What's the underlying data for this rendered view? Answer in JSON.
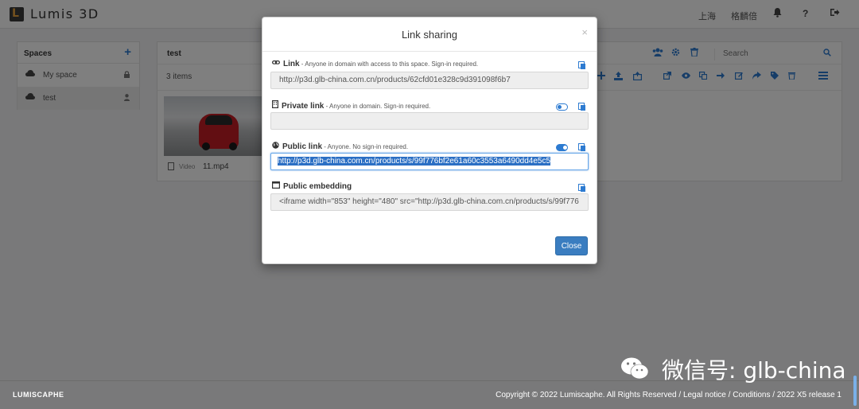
{
  "header": {
    "app_name": "Lumis 3D",
    "location": "上海",
    "user": "格麟倍",
    "bell_icon": "bell-icon",
    "help_label": "?",
    "logout_icon": "sign-out-icon"
  },
  "spaces": {
    "title": "Spaces",
    "add_label": "+",
    "items": [
      {
        "name": "My space",
        "icon": "lock-icon"
      },
      {
        "name": "test",
        "icon": "user-icon"
      }
    ]
  },
  "main": {
    "title": "test",
    "items_count": "3 items",
    "search_placeholder": "Search",
    "file": {
      "type": "Video",
      "name": "11.mp4"
    }
  },
  "modal": {
    "title": "Link sharing",
    "close_x": "×",
    "link": {
      "label": "Link",
      "desc": " - Anyone in domain with access to this space. Sign-in required.",
      "value": "http://p3d.glb-china.com.cn/products/62cfd01e328c9d391098f6b7"
    },
    "private_link": {
      "label": "Private link",
      "desc": " - Anyone in domain. Sign-in required.",
      "value": "",
      "enabled": false
    },
    "public_link": {
      "label": "Public link",
      "desc": " - Anyone. No sign-in required.",
      "value": "http://p3d.glb-china.com.cn/products/s/99f776bf2e61a60c3553a6490dd4e5c5",
      "enabled": true
    },
    "public_embedding": {
      "label": "Public embedding",
      "value": "<iframe width=\"853\" height=\"480\" src=\"http://p3d.glb-china.com.cn/products/s/99f776"
    },
    "close_button": "Close"
  },
  "footer": {
    "logo": "LUMISCAPHE",
    "copyright": "Copyright © 2022 Lumiscaphe. All Rights Reserved / ",
    "legal": "Legal notice",
    "sep1": " / ",
    "conditions": "Conditions",
    "release": " / 2022 X5 release 1"
  },
  "watermark": "微信号: glb-china",
  "colors": {
    "accent": "#2d7bd1",
    "button": "#3a7dc0",
    "selection": "#2b6fc4"
  }
}
